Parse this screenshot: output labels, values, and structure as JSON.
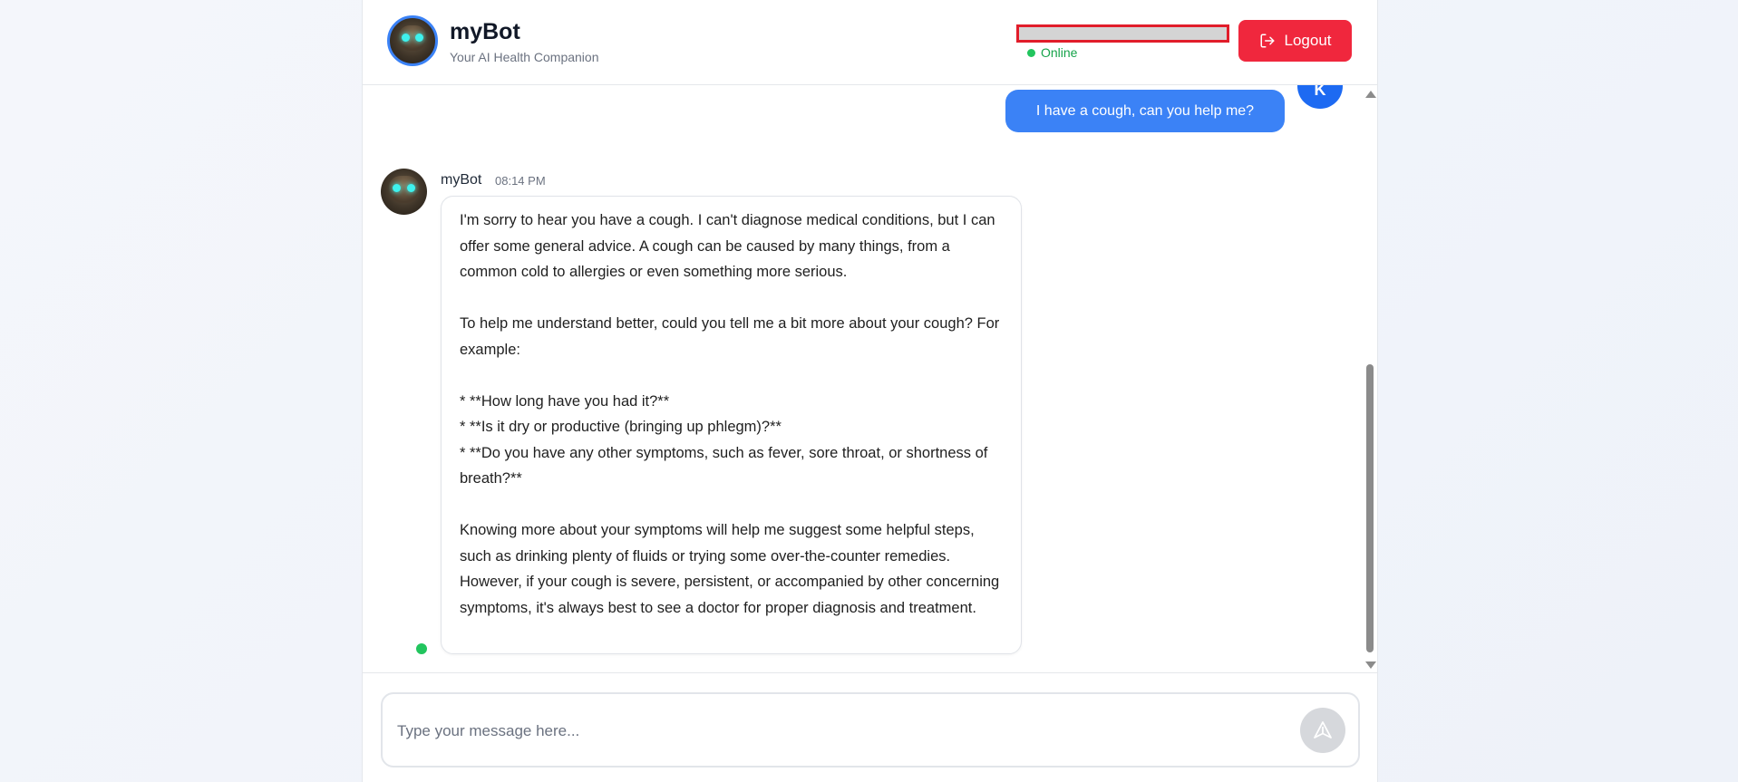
{
  "header": {
    "title": "myBot",
    "subtitle": "Your AI Health Companion",
    "status": "Online",
    "logout_label": "Logout"
  },
  "chat": {
    "user_avatar_initial": "K",
    "user_message": "I have a cough, can you help me?",
    "bot": {
      "name": "myBot",
      "time": "08:14 PM",
      "paragraphs": [
        "I'm sorry to hear you have a cough.  I can't diagnose medical conditions, but I can offer some general advice.  A cough can be caused by many things, from a common cold to allergies or even something more serious.",
        "To help me understand better, could you tell me a bit more about your cough?  For example:",
        "* **How long have you had it?**",
        "* **Is it dry or productive (bringing up phlegm)?**",
        "* **Do you have any other symptoms, such as fever, sore throat, or shortness of breath?**",
        "Knowing more about your symptoms will help me suggest some helpful steps, such as drinking plenty of fluids or trying some over-the-counter remedies.  However,  if your cough is severe, persistent, or accompanied by other concerning symptoms, it's always best to see a doctor for proper diagnosis and treatment."
      ]
    }
  },
  "input": {
    "placeholder": "Type your message here..."
  },
  "icons": {
    "logout": "logout-icon",
    "send": "send-icon"
  },
  "colors": {
    "accent": "#3b82f6",
    "logout": "#f0273d",
    "online": "#22c55e"
  }
}
